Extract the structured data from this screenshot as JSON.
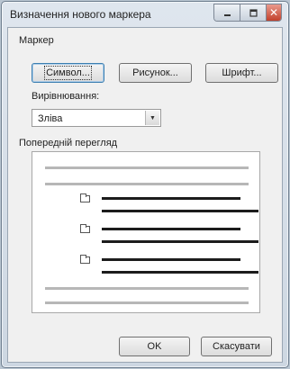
{
  "dialog": {
    "title": "Визначення нового маркера"
  },
  "window_controls": {
    "close_glyph": "✕"
  },
  "marker_group": {
    "label": "Маркер",
    "symbol_button": "Символ...",
    "picture_button": "Рисунок...",
    "font_button": "Шрифт..."
  },
  "alignment": {
    "label": "Вирівнювання:",
    "value": "Зліва",
    "arrow_glyph": "▼"
  },
  "preview": {
    "label": "Попередній перегляд"
  },
  "footer": {
    "ok_label": "OK",
    "cancel_label": "Скасувати"
  },
  "icons": [
    "minimize-icon",
    "maximize-icon",
    "close-icon",
    "chevron-down-icon",
    "bullet-picture-icon"
  ]
}
